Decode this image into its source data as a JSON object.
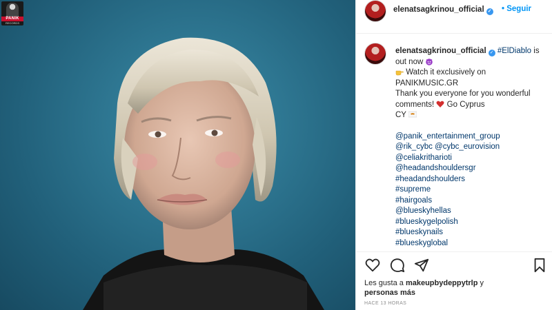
{
  "post": {
    "logo": {
      "brand": "PANIK",
      "sub": "RECORDS"
    },
    "header": {
      "username": "elenatsagkrinou_official",
      "separator": "•",
      "follow_label": "Seguir"
    },
    "caption": {
      "username": "elenatsagkrinou_official",
      "hashtag_title": "#ElDiablo",
      "line1_rest": "is out now",
      "line2": "Watch it exclusively on PANIKMUSIC.GR",
      "line3": "Thank you everyone for you wonderful comments!",
      "line3b": "Go Cyprus",
      "line3c": "CY",
      "tags": [
        "@panik_entertainment_group",
        "@rik_cybc @cybc_eurovision",
        "@celiakritharioti",
        "@headandshouldersgr",
        "#headandshoulders",
        "#supreme",
        "#hairgoals",
        "@blueskyhellas",
        "#blueskygelpolish",
        "#blueskynails",
        "#blueskyglobal"
      ]
    },
    "likes": {
      "prefix": "Les gusta a",
      "user": "makeupbydeppytrlp",
      "suffix": "y",
      "more": "personas más"
    },
    "timestamp": "HACE 13 HORAS"
  },
  "icons": [
    "heart-icon",
    "comment-icon",
    "share-icon",
    "bookmark-icon",
    "verified-icon",
    "devil-emoji",
    "pointing-hand-emoji",
    "red-heart-emoji",
    "flag-emoji"
  ],
  "colors": {
    "link": "#00376b",
    "follow": "#0095f6",
    "verified": "#3897f0",
    "text": "#262626",
    "muted": "#8e8e8e"
  }
}
